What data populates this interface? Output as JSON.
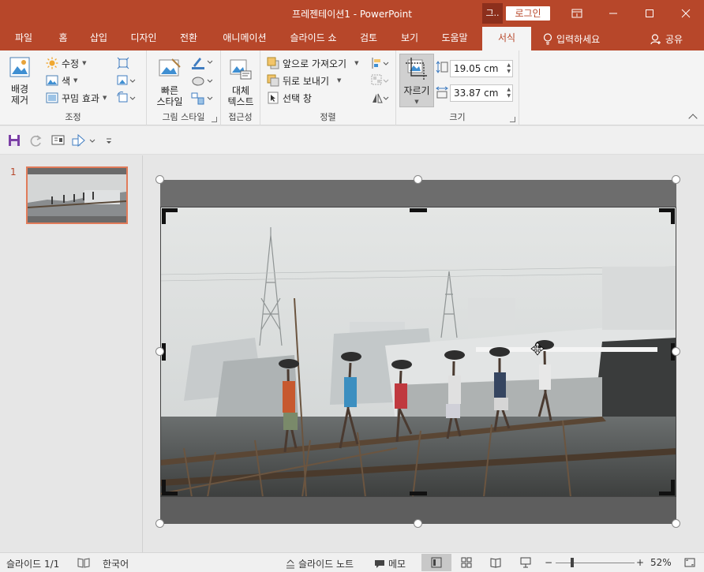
{
  "app": {
    "title": "프레젠테이션1  -  PowerPoint",
    "user_initial": "그..",
    "login_label": "로그인"
  },
  "tabs": [
    {
      "label": "파일"
    },
    {
      "label": "홈"
    },
    {
      "label": "삽입"
    },
    {
      "label": "디자인"
    },
    {
      "label": "전환"
    },
    {
      "label": "애니메이션"
    },
    {
      "label": "슬라이드 쇼"
    },
    {
      "label": "검토"
    },
    {
      "label": "보기"
    },
    {
      "label": "도움말"
    },
    {
      "label": "서식"
    }
  ],
  "tell_me": "입력하세요",
  "share": "공유",
  "ribbon": {
    "adjust": {
      "remove_bg_line1": "배경",
      "remove_bg_line2": "제거",
      "corrections": "수정",
      "color": "색",
      "artistic": "꾸밈 효과",
      "label": "조정"
    },
    "styles": {
      "quick_line1": "빠른",
      "quick_line2": "스타일",
      "label": "그림 스타일"
    },
    "accessibility": {
      "alt_line1": "대체",
      "alt_line2": "텍스트",
      "label": "접근성"
    },
    "arrange": {
      "bring_forward": "앞으로 가져오기",
      "send_backward": "뒤로 보내기",
      "selection_pane": "선택 창",
      "label": "정렬"
    },
    "size": {
      "crop": "자르기",
      "height": "19.05 cm",
      "width": "33.87 cm",
      "label": "크기"
    }
  },
  "thumbnail": {
    "number": "1"
  },
  "status": {
    "slide": "슬라이드 1/1",
    "language": "한국어",
    "notes": "슬라이드 노트",
    "comments": "메모",
    "zoom": "52%"
  },
  "colors": {
    "accent": "#b7472a",
    "ribbon_bg": "#f4f4f4",
    "workspace": "#e6e6e6"
  }
}
